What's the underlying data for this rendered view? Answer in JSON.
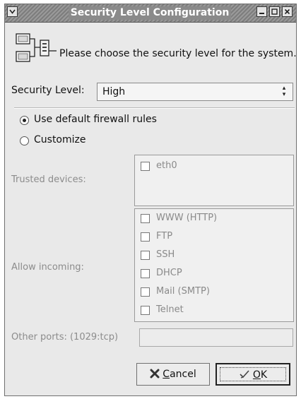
{
  "window": {
    "title": "Security Level Configuration"
  },
  "titlebar": {
    "menu_icon": "chevron-down-icon",
    "minimize_icon": "minimize-icon",
    "maximize_icon": "maximize-icon",
    "close_icon": "close-icon"
  },
  "header": {
    "icon": "network-firewall-icon",
    "text": "Please choose the security level for the system."
  },
  "security_level": {
    "label": "Security Level:",
    "value": "High"
  },
  "firewall": {
    "default_label": "Use default firewall rules",
    "default_selected": true,
    "customize_label": "Customize",
    "customize_selected": false
  },
  "trusted_devices": {
    "label": "Trusted devices:",
    "items": [
      {
        "label": "eth0",
        "checked": false
      }
    ]
  },
  "allow_incoming": {
    "label": "Allow incoming:",
    "items": [
      {
        "label": "WWW (HTTP)",
        "checked": false
      },
      {
        "label": "FTP",
        "checked": false
      },
      {
        "label": "SSH",
        "checked": false
      },
      {
        "label": "DHCP",
        "checked": false
      },
      {
        "label": "Mail (SMTP)",
        "checked": false
      },
      {
        "label": "Telnet",
        "checked": false
      }
    ]
  },
  "other_ports": {
    "label": "Other ports: (1029:tcp)",
    "value": ""
  },
  "buttons": {
    "cancel_mnemonic": "C",
    "cancel_rest": "ancel",
    "ok_mnemonic": "O",
    "ok_rest": "K"
  },
  "colors": {
    "window_bg": "#e9e9e9",
    "titlebar": "#8a8a8a",
    "disabled_text": "#8c8c8c"
  }
}
